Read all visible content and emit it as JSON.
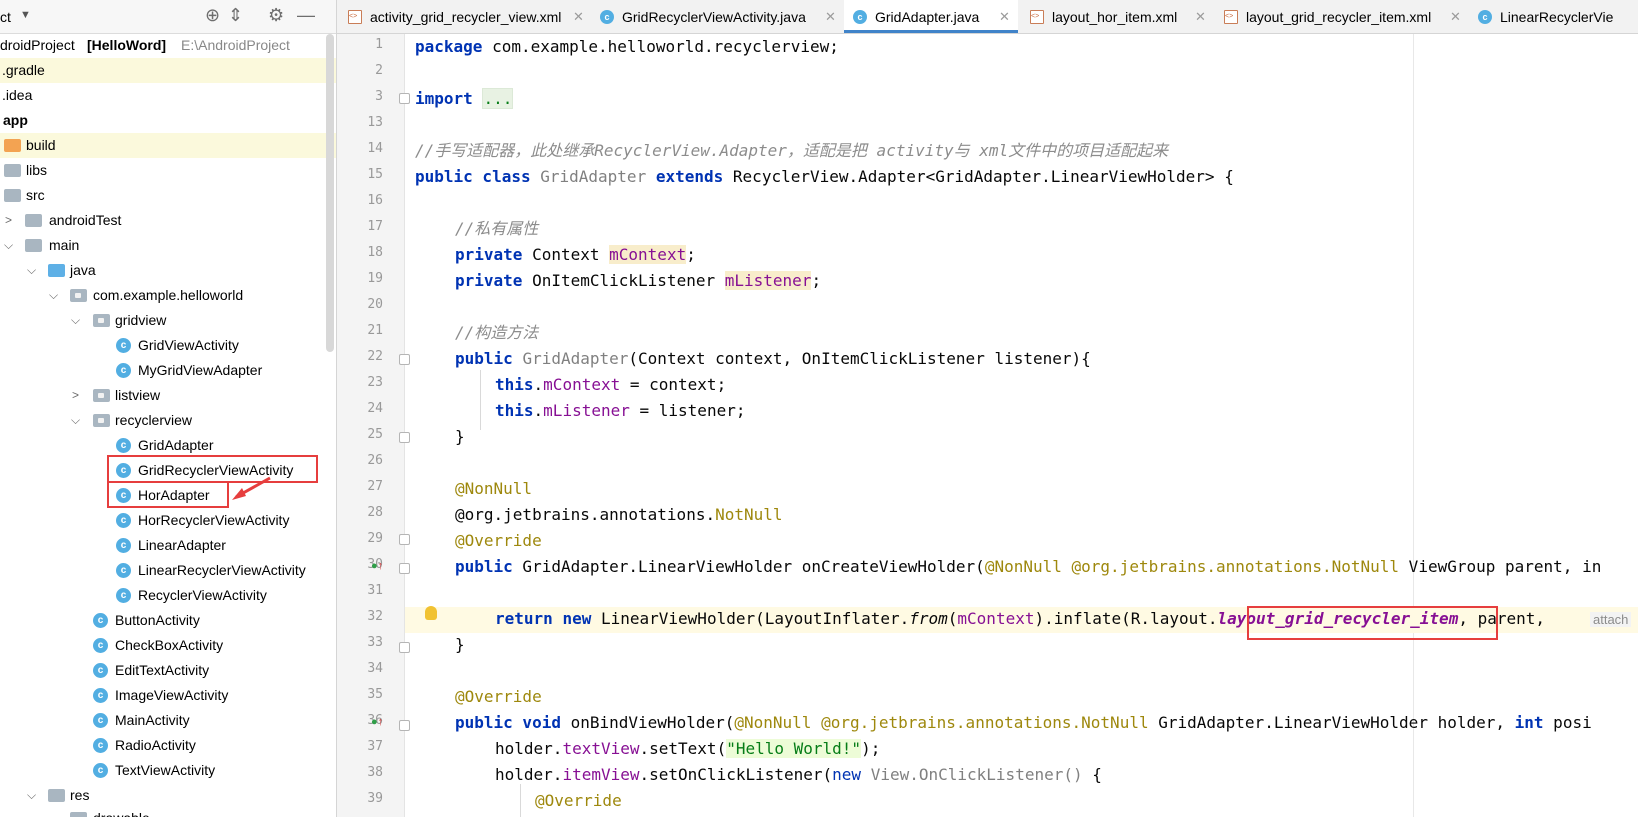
{
  "project_panel": {
    "title": "ct",
    "root": {
      "name": "droidProject",
      "module": "[HelloWord]",
      "path": "E:\\AndroidProject"
    },
    "items": [
      {
        "label": ".gradle"
      },
      {
        "label": ".idea"
      },
      {
        "label": "app"
      },
      {
        "label": "build"
      },
      {
        "label": "libs"
      },
      {
        "label": "src"
      },
      {
        "label": "androidTest"
      },
      {
        "label": "main"
      },
      {
        "label": "java"
      },
      {
        "label": "com.example.helloworld"
      },
      {
        "label": "gridview"
      },
      {
        "label": "GridViewActivity"
      },
      {
        "label": "MyGridViewAdapter"
      },
      {
        "label": "listview"
      },
      {
        "label": "recyclerview"
      },
      {
        "label": "GridAdapter"
      },
      {
        "label": "GridRecyclerViewActivity"
      },
      {
        "label": "HorAdapter"
      },
      {
        "label": "HorRecyclerViewActivity"
      },
      {
        "label": "LinearAdapter"
      },
      {
        "label": "LinearRecyclerViewActivity"
      },
      {
        "label": "RecyclerViewActivity"
      },
      {
        "label": "ButtonActivity"
      },
      {
        "label": "CheckBoxActivity"
      },
      {
        "label": "EditTextActivity"
      },
      {
        "label": "ImageViewActivity"
      },
      {
        "label": "MainActivity"
      },
      {
        "label": "RadioActivity"
      },
      {
        "label": "TextViewActivity"
      },
      {
        "label": "res"
      },
      {
        "label": "drawable"
      }
    ]
  },
  "tabs": [
    {
      "label": "activity_grid_recycler_view.xml",
      "type": "xml"
    },
    {
      "label": "GridRecyclerViewActivity.java",
      "type": "java"
    },
    {
      "label": "GridAdapter.java",
      "type": "java",
      "active": true
    },
    {
      "label": "layout_hor_item.xml",
      "type": "xml"
    },
    {
      "label": "layout_grid_recycler_item.xml",
      "type": "xml"
    },
    {
      "label": "LinearRecyclerVie",
      "type": "java"
    }
  ],
  "editor": {
    "line_numbers": [
      "1",
      "2",
      "3",
      "13",
      "14",
      "15",
      "16",
      "17",
      "18",
      "19",
      "20",
      "21",
      "22",
      "23",
      "24",
      "25",
      "26",
      "27",
      "28",
      "29",
      "30",
      "31",
      "32",
      "33",
      "34",
      "35",
      "36",
      "37",
      "38",
      "39"
    ],
    "code": {
      "l1_kw": "package",
      "l1_rest": " com.example.helloworld.recyclerview;",
      "l3_kw": "import",
      "l3_fold": "...",
      "l14": "//手写适配器，此处继承RecyclerView.Adapter，适配是把 activity与 xml文件中的项目适配起来",
      "l15_kw1": "public class",
      "l15_name": "GridAdapter",
      "l15_kw2": "extends",
      "l15_rest": " RecyclerView.Adapter<GridAdapter.LinearViewHolder> {",
      "l17": "//私有属性",
      "l18_kw": "private",
      "l18_type": " Context ",
      "l18_fld": "mContext",
      "l19_kw": "private",
      "l19_type": " OnItemClickListener ",
      "l19_fld": "mListener",
      "l21": "//构造方法",
      "l22_kw": "public",
      "l22_name": "GridAdapter",
      "l22_rest": "(Context context, OnItemClickListener listener){",
      "l23_kw": "this",
      "l23_fld": "mContext",
      "l23_rest": " = context;",
      "l24_kw": "this",
      "l24_fld": "mListener",
      "l24_rest": " = listener;",
      "brace": "}",
      "l27": "@NonNull",
      "l28_pre": "@org.jetbrains.annotations.",
      "l28_ann": "NotNull",
      "l29": "@Override",
      "l30_kw": "public",
      "l30_a": " GridAdapter.LinearViewHolder onCreateViewHolder(",
      "l30_ann1": "@NonNull",
      "l30_ann2": "@org.jetbrains.annotations.",
      "l30_ann3": "NotNull",
      "l30_b": " ViewGroup parent, in",
      "l32_kw1": "return",
      "l32_kw2": "new",
      "l32_a": " LinearViewHolder(LayoutInflater.",
      "l32_from": "from",
      "l32_b": "(",
      "l32_fld": "mContext",
      "l32_c": ").inflate(R.layout.",
      "l32_res": "layout_grid_recycler_item",
      "l32_d": ", parent, ",
      "l32_hint": "attach",
      "l35": "@Override",
      "l36_kw": "public void",
      "l36_a": " onBindViewHolder(",
      "l36_ann1": "@NonNull",
      "l36_ann2": "@org.jetbrains.annotations.",
      "l36_ann3": "NotNull",
      "l36_b": " GridAdapter.LinearViewHolder holder, ",
      "l36_kw2": "int",
      "l36_c": " posi",
      "l37_a": "holder.",
      "l37_fld": "textView",
      "l37_b": ".setText(",
      "l37_str": "\"Hello World!\"",
      "l37_c": ");",
      "l38_a": "holder.",
      "l38_fld": "itemView",
      "l38_b": ".setOnClickListener(",
      "l38_kw": "new",
      "l38_gry": " View.OnClickListener()",
      "l38_c": " {",
      "l39": "@Override"
    }
  },
  "colors": {
    "highlight_box": "#e63e3e",
    "accent": "#4083c9"
  }
}
